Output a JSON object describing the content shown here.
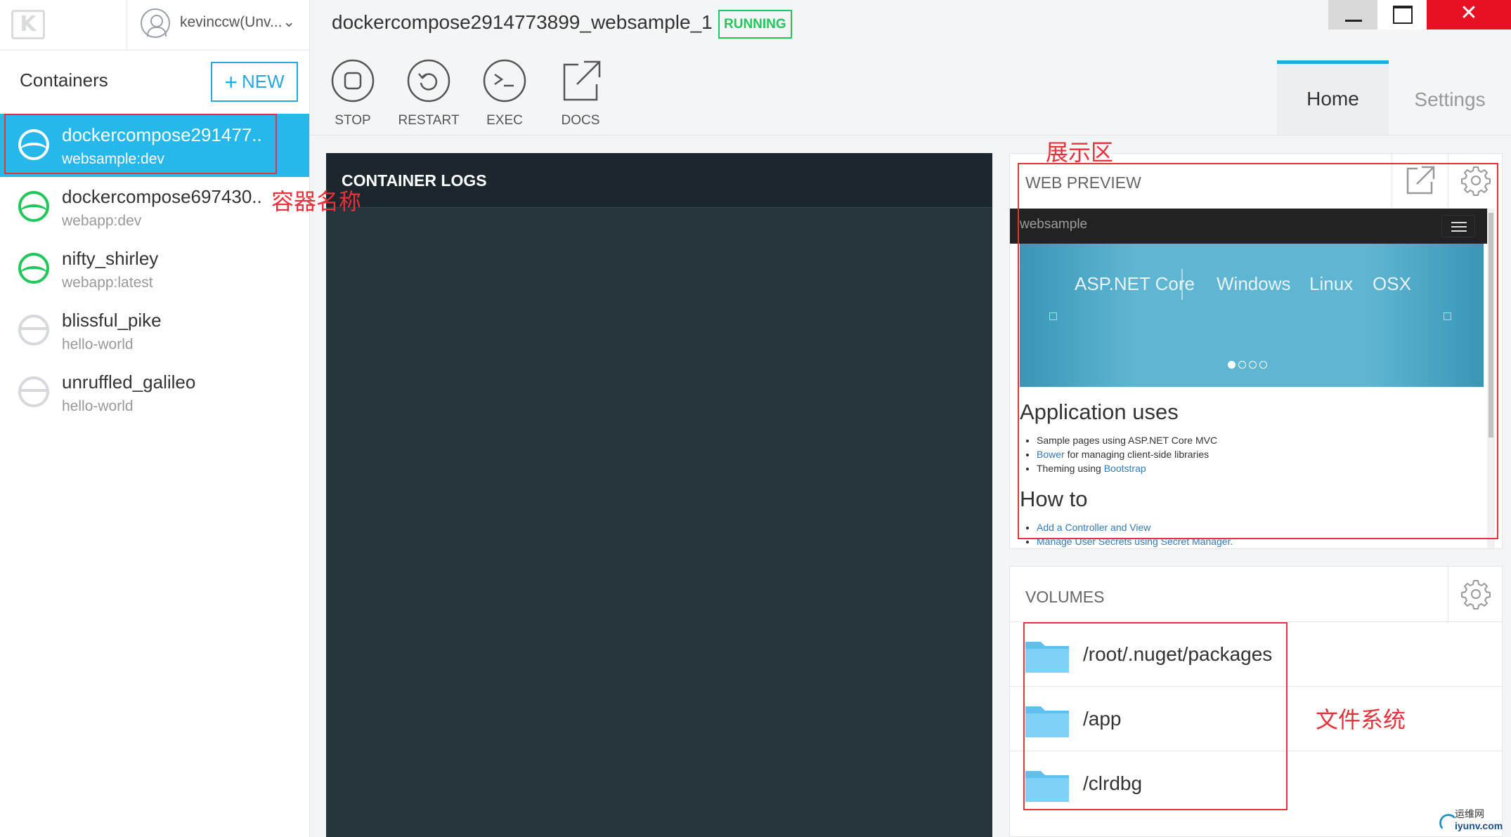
{
  "account": {
    "name": "kevinccw(Unv..."
  },
  "sidebar": {
    "title": "Containers",
    "new_button_plus": "+",
    "new_button_label": "NEW",
    "containers": [
      {
        "name": "dockercompose291477..",
        "image": "websample:dev",
        "state": "running",
        "active": true
      },
      {
        "name": "dockercompose697430..",
        "image": "webapp:dev",
        "state": "running",
        "active": false
      },
      {
        "name": "nifty_shirley",
        "image": "webapp:latest",
        "state": "running",
        "active": false
      },
      {
        "name": "blissful_pike",
        "image": "hello-world",
        "state": "stopped",
        "active": false
      },
      {
        "name": "unruffled_galileo",
        "image": "hello-world",
        "state": "stopped",
        "active": false
      }
    ]
  },
  "header": {
    "container_title": "dockercompose2914773899_websample_1",
    "status": "RUNNING",
    "window_close": "✕"
  },
  "toolbar": {
    "stop": "STOP",
    "restart": "RESTART",
    "exec": "EXEC",
    "docs": "DOCS"
  },
  "tabs": {
    "home": "Home",
    "settings": "Settings"
  },
  "logs": {
    "title": "CONTAINER LOGS"
  },
  "web_preview": {
    "title": "WEB PREVIEW",
    "brand": "websample",
    "carousel_tabs": [
      "ASP.NET Core",
      "Windows",
      "Linux",
      "OSX"
    ],
    "carousel_active_index": 0,
    "section1_title": "Application uses",
    "section1_items": [
      {
        "text": "Sample pages using ASP.NET Core MVC",
        "link": ""
      },
      {
        "link": "Bower",
        "text": " for managing client-side libraries"
      },
      {
        "text": "Theming using ",
        "link": "Bootstrap"
      }
    ],
    "section2_title": "How to",
    "section2_items": [
      "Add a Controller and View",
      "Manage User Secrets using Secret Manager."
    ]
  },
  "volumes": {
    "title": "VOLUMES",
    "items": [
      "/root/.nuget/packages",
      "/app",
      "/clrdbg"
    ]
  },
  "annotations": {
    "display_area": "展示区",
    "container_name": "容器名称",
    "file_system": "文件系统"
  },
  "watermark": {
    "text": "运维网",
    "url": "iyunv.com"
  },
  "colors": {
    "accent": "#26b8ea",
    "running": "#22c75c",
    "annotation": "#e8313b",
    "logs_bg": "#26343c"
  }
}
